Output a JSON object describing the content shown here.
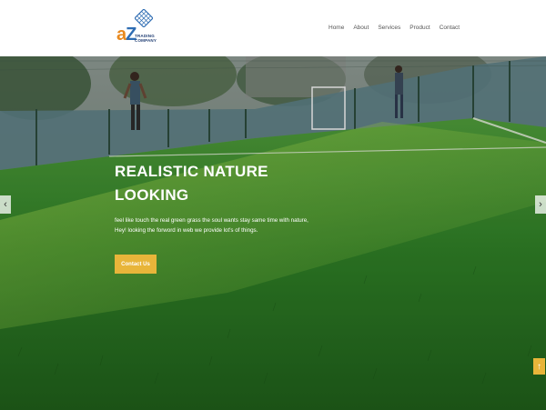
{
  "brand": {
    "logo_letters_a": "a",
    "logo_letters_z": "Z",
    "logo_sub_line1": "TRADING",
    "logo_sub_line2": "COMPANY"
  },
  "nav": {
    "items": [
      "Home",
      "About",
      "Services",
      "Product",
      "Contact"
    ]
  },
  "hero": {
    "title_line1": "REALISTIC NATURE",
    "title_line2": "LOOKING",
    "text_line1": "feel like touch the real green grass the soul wants stay same time with nature,",
    "text_line2": "Hey! looking the forword in web we provide lot's of things.",
    "cta_label": "Contact Us",
    "prev_icon": "chevron-left-icon",
    "next_icon": "chevron-right-icon"
  },
  "back_to_top": {
    "icon": "arrow-up-icon",
    "glyph": "↑"
  },
  "colors": {
    "accent": "#e8b53a",
    "logo_orange": "#e98a1f",
    "logo_blue": "#2f6db3",
    "turf": "#2f7d2a"
  }
}
